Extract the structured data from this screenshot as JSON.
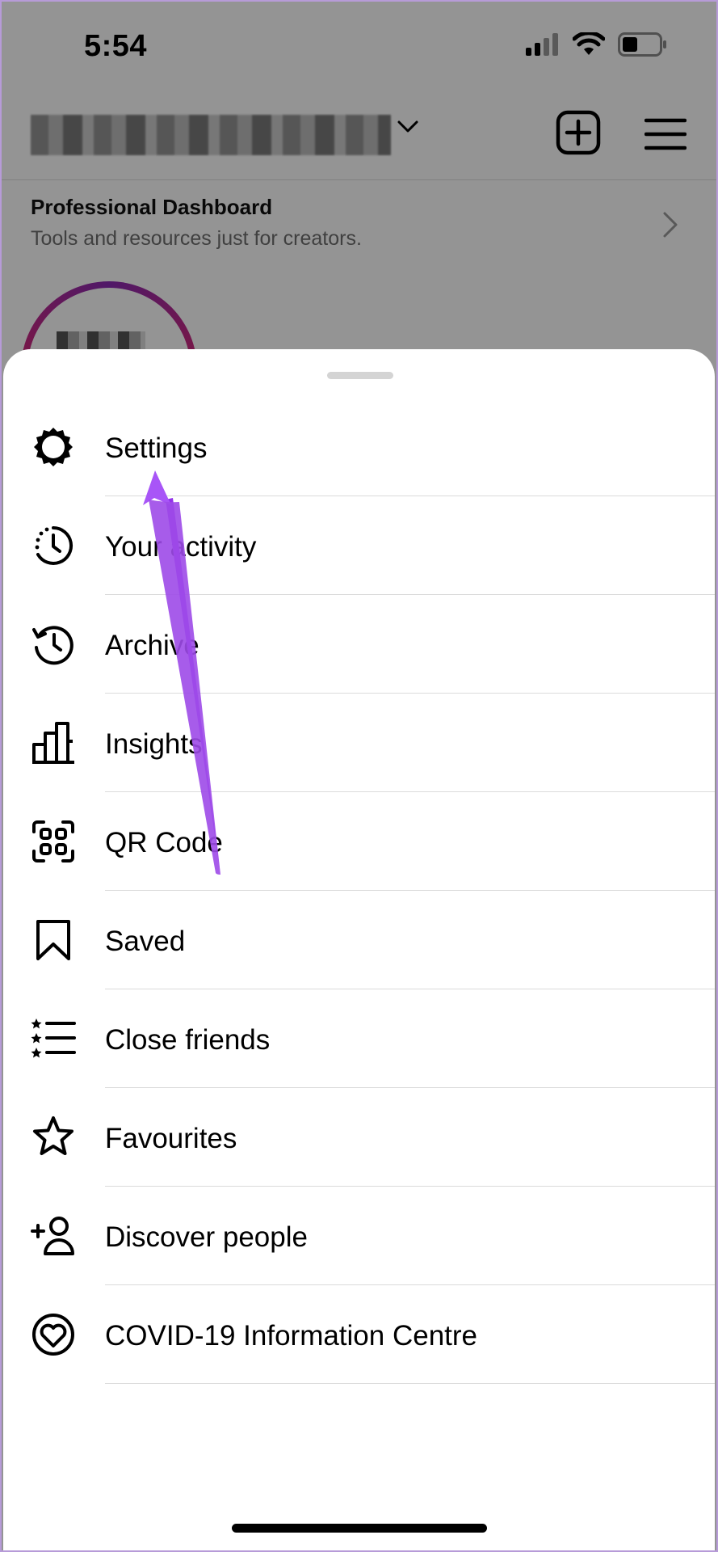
{
  "status_bar": {
    "time": "5:54"
  },
  "dashboard": {
    "title": "Professional Dashboard",
    "subtitle": "Tools and resources just for creators."
  },
  "sheet": {
    "items": [
      {
        "label": "Settings",
        "icon": "gear-icon"
      },
      {
        "label": "Your activity",
        "icon": "activity-clock-icon"
      },
      {
        "label": "Archive",
        "icon": "archive-history-icon"
      },
      {
        "label": "Insights",
        "icon": "bar-chart-icon"
      },
      {
        "label": "QR Code",
        "icon": "qr-code-icon"
      },
      {
        "label": "Saved",
        "icon": "bookmark-icon"
      },
      {
        "label": "Close friends",
        "icon": "close-friends-list-icon"
      },
      {
        "label": "Favourites",
        "icon": "star-icon"
      },
      {
        "label": "Discover people",
        "icon": "add-person-icon"
      },
      {
        "label": "COVID-19 Information Centre",
        "icon": "covid-heart-icon"
      }
    ]
  },
  "colors": {
    "annotation_arrow": "#a855f7",
    "overlay": "#000000",
    "sheet_background": "#ffffff",
    "divider": "#dbdbdb"
  }
}
